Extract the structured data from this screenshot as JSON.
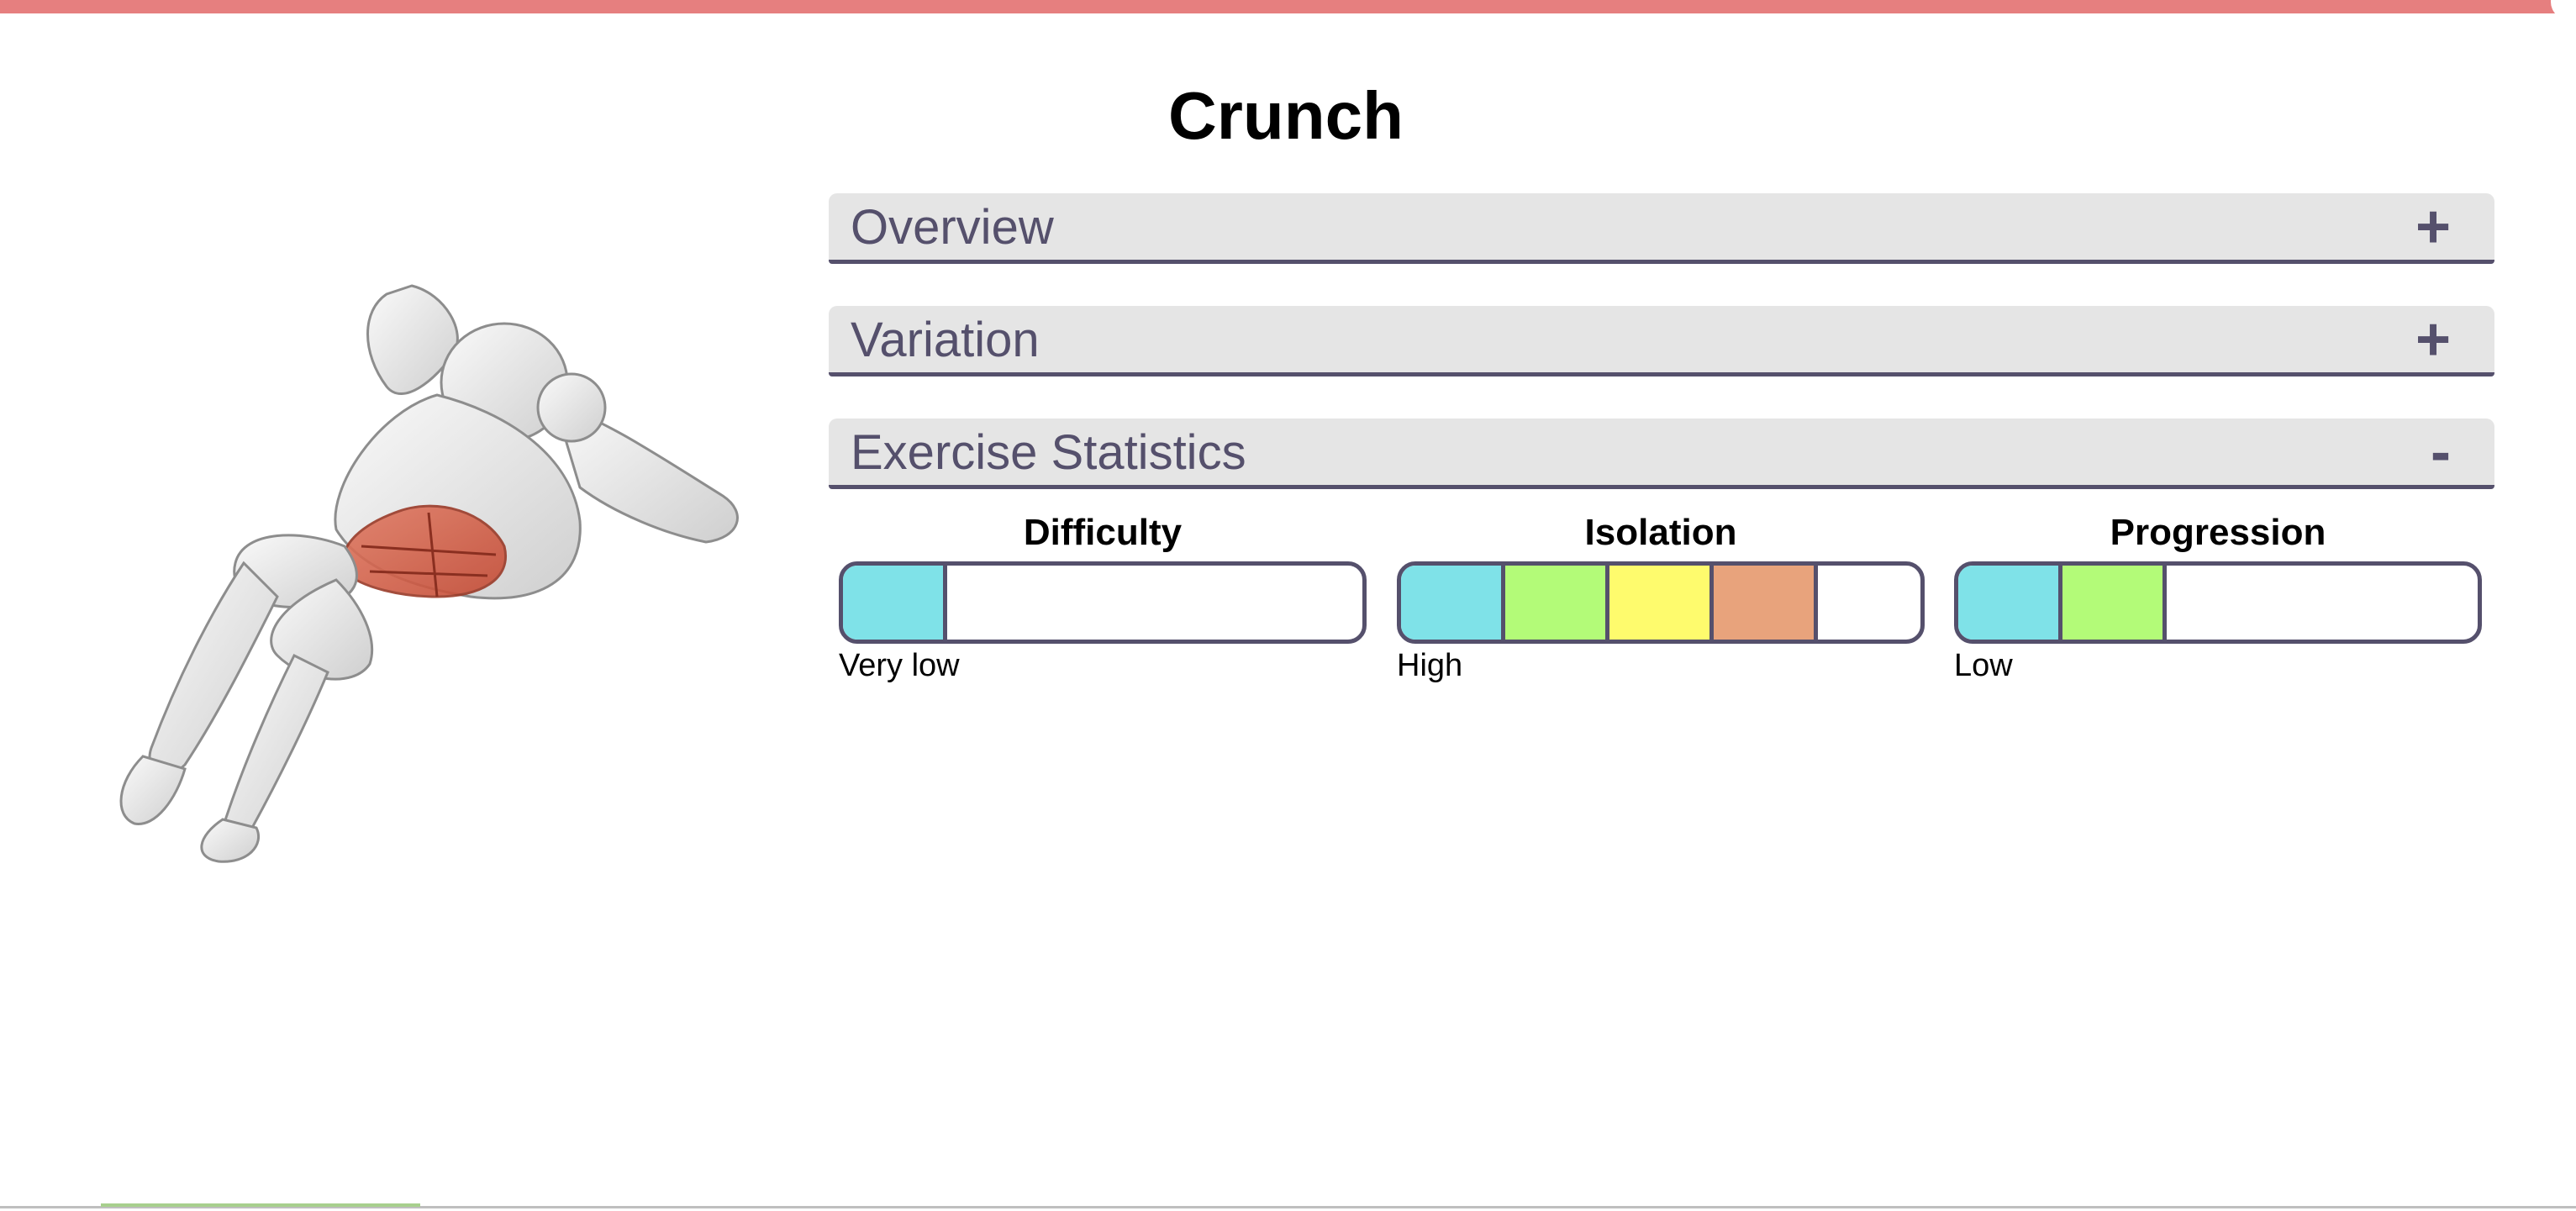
{
  "exercise": {
    "title": "Crunch"
  },
  "sections": [
    {
      "label": "Overview",
      "toggle": "+",
      "expanded": false
    },
    {
      "label": "Variation",
      "toggle": "+",
      "expanded": false
    },
    {
      "label": "Exercise Statistics",
      "toggle": "-",
      "expanded": true
    }
  ],
  "statistics": [
    {
      "title": "Difficulty",
      "level_label": "Very low",
      "level": 1,
      "max_level": 5
    },
    {
      "title": "Isolation",
      "level_label": "High",
      "level": 4,
      "max_level": 5
    },
    {
      "title": "Progression",
      "level_label": "Low",
      "level": 2,
      "max_level": 5
    }
  ],
  "colors": {
    "top_bar": "#e67f7f",
    "accent": "#55506c",
    "header_bg": "#e5e5e5",
    "level_colors": [
      "#7fe2e8",
      "#b3fb78",
      "#fefb6d",
      "#e8a37c",
      "#ffffff"
    ],
    "muscle_highlight": "#d9583e"
  },
  "illustration": {
    "icon": "crunch-figure-illustration"
  }
}
